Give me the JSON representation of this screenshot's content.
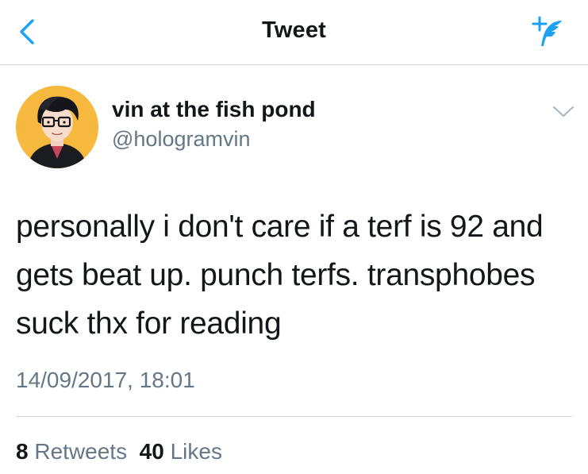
{
  "header": {
    "title": "Tweet",
    "back_icon": "chevron-left-icon",
    "compose_icon": "compose-tweet-icon",
    "accent_color": "#1da1f2"
  },
  "tweet": {
    "author": {
      "name": "vin at the fish pond",
      "handle": "@hologramvin",
      "avatar_background": "#f6b83e"
    },
    "text": "personally i don't care if a terf is 92 and gets beat up. punch terfs. transphobes suck thx for reading",
    "timestamp": "14/09/2017, 18:01",
    "stats": {
      "retweets_count": "8",
      "retweets_label": "Retweets",
      "likes_count": "40",
      "likes_label": "Likes"
    }
  }
}
